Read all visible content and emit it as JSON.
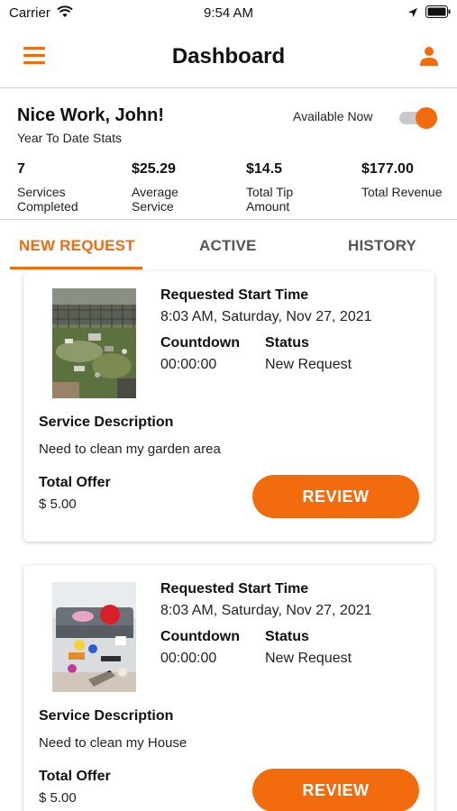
{
  "status_bar": {
    "carrier": "Carrier",
    "time": "9:54 AM"
  },
  "header": {
    "title": "Dashboard",
    "menu_icon": "hamburger-menu-icon",
    "profile_icon": "user-icon"
  },
  "summary": {
    "greeting": "Nice Work, John!",
    "subtitle": "Year To Date Stats",
    "availability_label": "Available Now",
    "availability_on": true,
    "stats": [
      {
        "value": "7",
        "label": "Services Completed"
      },
      {
        "value": "$25.29",
        "label": "Average Service"
      },
      {
        "value": "$14.5",
        "label": "Total Tip Amount"
      },
      {
        "value": "$177.00",
        "label": "Total Revenue"
      }
    ]
  },
  "tabs": [
    {
      "label": "NEW REQUEST",
      "active": true
    },
    {
      "label": "ACTIVE",
      "active": false
    },
    {
      "label": "HISTORY",
      "active": false
    }
  ],
  "requests": [
    {
      "start_time_label": "Requested Start Time",
      "start_time": "8:03 AM, Saturday, Nov 27, 2021",
      "countdown_label": "Countdown",
      "countdown": "00:00:00",
      "status_label": "Status",
      "status": "New Request",
      "description_label": "Service Description",
      "description": "Need to clean my garden area",
      "offer_label": "Total Offer",
      "offer": "$ 5.00",
      "button_label": "REVIEW"
    },
    {
      "start_time_label": "Requested Start Time",
      "start_time": "8:03 AM, Saturday, Nov 27, 2021",
      "countdown_label": "Countdown",
      "countdown": "00:00:00",
      "status_label": "Status",
      "status": "New Request",
      "description_label": "Service Description",
      "description": "Need to clean my House",
      "offer_label": "Total Offer",
      "offer": "$ 5.00",
      "button_label": "REVIEW"
    }
  ],
  "colors": {
    "accent": "#f26b0f",
    "divider": "#cfcfcf",
    "toggle_track": "#c9c9c9"
  }
}
